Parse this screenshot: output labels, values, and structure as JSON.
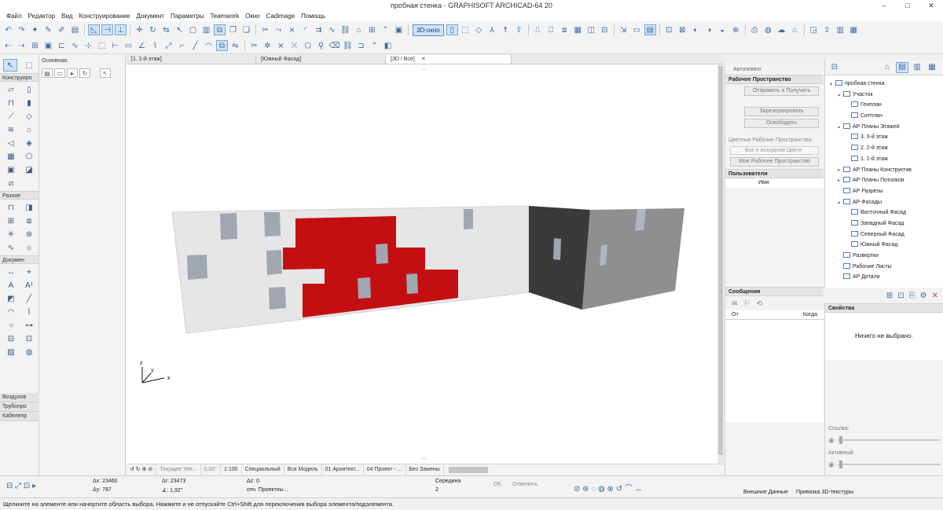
{
  "window": {
    "title": "пробная стенка - GRAPHISOFT ARCHICAD-64 20",
    "controls": [
      "–",
      "□",
      "✕"
    ]
  },
  "menu": [
    "Файл",
    "Редактор",
    "Вид",
    "Конструирование",
    "Документ",
    "Параметры",
    "Teamwork",
    "Окно",
    "Cadimage",
    "Помощь"
  ],
  "toolbar": {
    "view3d_label": "3D-окно"
  },
  "toolbox": {
    "construct_header": "Конструиро",
    "misc_header": "Разное",
    "document_header": "Докумен",
    "collapsed": [
      "Воздухов",
      "Трубопро",
      "Кабелепр"
    ]
  },
  "infobox": {
    "label": "Основная:"
  },
  "tabs": [
    {
      "label": "[1. 1-й этаж]",
      "active": false
    },
    {
      "label": "[Южный Фасад]",
      "active": false
    },
    {
      "label": "[3D / Все]",
      "active": true
    }
  ],
  "axes": {
    "z": "z",
    "y": "y",
    "x": "x"
  },
  "navbar": {
    "view_label": "Текущее Уве...",
    "angle": "0,00°",
    "scale": "1:100",
    "special": "Специальный",
    "model": "Вся Модель",
    "arch": "01 Архитект...",
    "project": "04 Проект - ...",
    "override": "Без Замены"
  },
  "organizer": {
    "standalone": "Автономно",
    "workspace_header": "Рабочее Пространство",
    "send_receive": "Отправить и Получить",
    "reserve": "Зарезервировать",
    "release": "Освободить",
    "color_ws_label": "Цветные Рабочие Пространства:",
    "color_ws_value": "Все в исходном Цвете",
    "my_ws": "Мое Рабочее Пространство",
    "users_header": "Пользователи",
    "user_name": "Имя",
    "messages_header": "Сообщения",
    "msg_from": "От",
    "msg_when": "Когда"
  },
  "navigator": {
    "tree": [
      {
        "label": "пробная стенка",
        "indent": 0,
        "tw": "▴"
      },
      {
        "label": "Участок",
        "indent": 1,
        "tw": "▴"
      },
      {
        "label": "Генплан",
        "indent": 2,
        "tw": ""
      },
      {
        "label": "Ситплан",
        "indent": 2,
        "tw": ""
      },
      {
        "label": "АР Планы Этажей",
        "indent": 1,
        "tw": "▴"
      },
      {
        "label": "3. 3-й этаж",
        "indent": 2,
        "tw": ""
      },
      {
        "label": "2. 2-й этаж",
        "indent": 2,
        "tw": ""
      },
      {
        "label": "1. 1-й этаж",
        "indent": 2,
        "tw": ""
      },
      {
        "label": "АР Планы Конструктив",
        "indent": 1,
        "tw": "▸"
      },
      {
        "label": "АР Планы Потолков",
        "indent": 1,
        "tw": "▸"
      },
      {
        "label": "АР Разрезы",
        "indent": 1,
        "tw": ""
      },
      {
        "label": "АР Фасады",
        "indent": 1,
        "tw": "▴"
      },
      {
        "label": "Восточный Фасад",
        "indent": 2,
        "tw": ""
      },
      {
        "label": "Западный Фасад",
        "indent": 2,
        "tw": ""
      },
      {
        "label": "Северный Фасад",
        "indent": 2,
        "tw": ""
      },
      {
        "label": "Южный Фасад",
        "indent": 2,
        "tw": ""
      },
      {
        "label": "Развертки",
        "indent": 1,
        "tw": ""
      },
      {
        "label": "Рабочие Листы",
        "indent": 1,
        "tw": ""
      },
      {
        "label": "АР Детали",
        "indent": 1,
        "tw": ""
      }
    ]
  },
  "properties": {
    "header": "Свойства",
    "empty": "Ничего не выбрано.",
    "link_label": "Ссылка:",
    "active_label": "Активный:"
  },
  "coords": {
    "dx": "Δx: 23460",
    "dy": "Δy: 787",
    "dr": "Δr: 23473",
    "angle": "∡: 1,92°",
    "dz": "Δz: 0",
    "rel": "отн. Проектны...",
    "snap": "Середина",
    "snap_n": "2",
    "ok": "OK",
    "cancel": "Отменить",
    "external": "Внешние Данные",
    "texture": "Привязка 3D-текстуры"
  },
  "status": "Щелкните на элементе или начертите область выбора. Нажмите и не отпускайте Ctrl+Shift для переключения выбора элемента/подэлемента."
}
